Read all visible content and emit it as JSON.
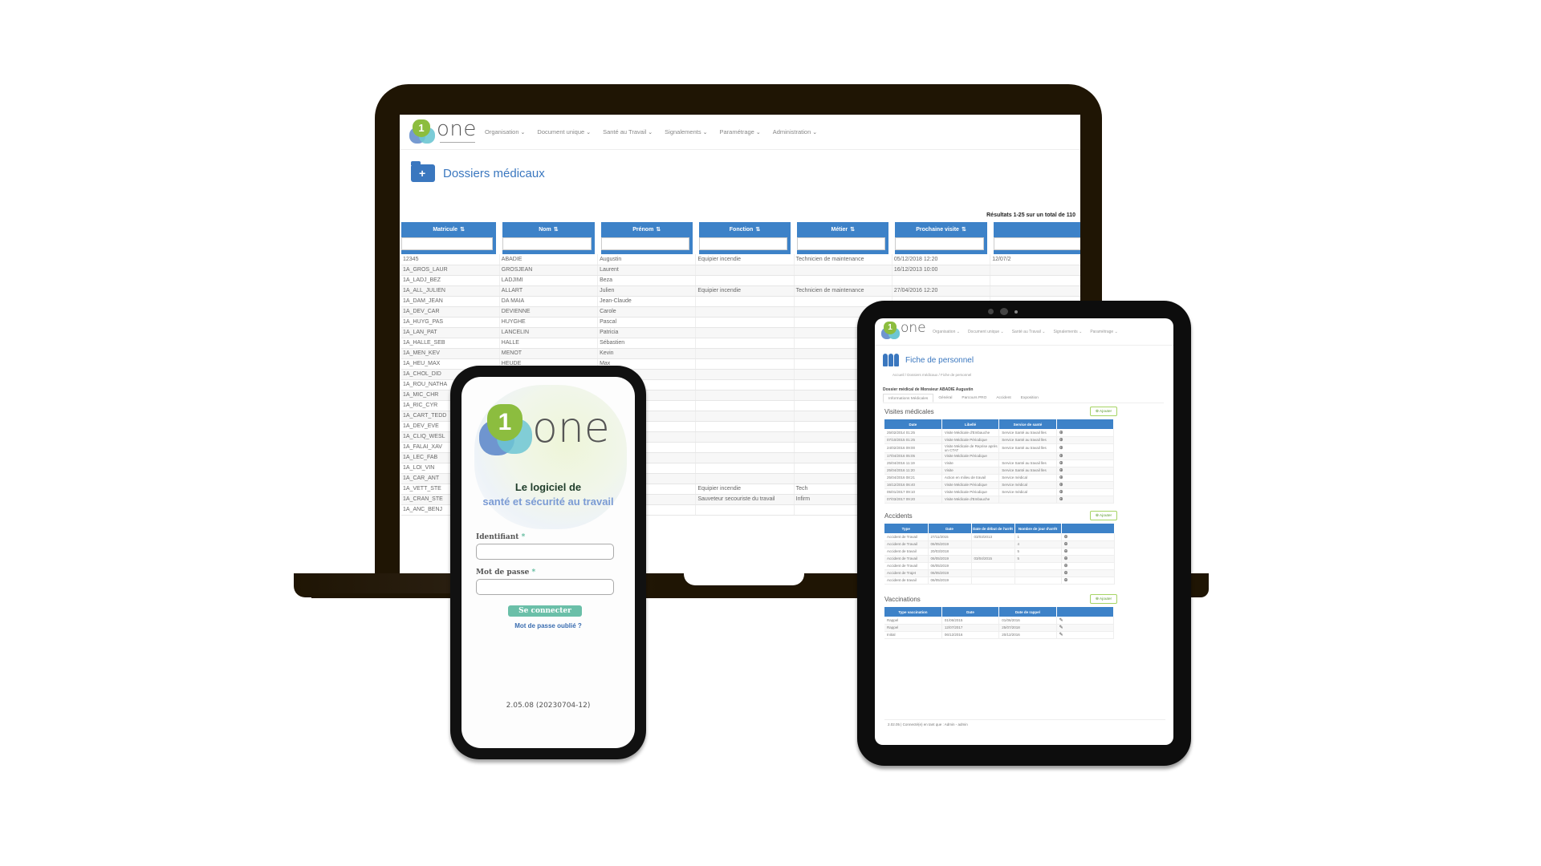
{
  "brand": {
    "logo_digit": "1",
    "logo_word": "one",
    "colors": {
      "green": "#8cbd3f",
      "blue": "#6f95cf",
      "teal": "#6dc6d3",
      "primary": "#3d82c8",
      "laptop_frame": "#1f1504"
    }
  },
  "laptop": {
    "nav": [
      {
        "label": "Organisation",
        "icon": "chevron-down-icon"
      },
      {
        "label": "Document unique",
        "icon": "chevron-down-icon"
      },
      {
        "label": "Santé au Travail",
        "icon": "chevron-down-icon"
      },
      {
        "label": "Signalements",
        "icon": "chevron-down-icon"
      },
      {
        "label": "Paramétrage",
        "icon": "chevron-down-icon"
      },
      {
        "label": "Administration",
        "icon": "chevron-down-icon"
      }
    ],
    "page_title": "Dossiers médicaux",
    "page_icon": "medical-folder-icon",
    "results_text": "Résultats 1-25 sur un total de 110",
    "columns": [
      "Matricule",
      "Nom",
      "Prénom",
      "Fonction",
      "Métier",
      "Prochaine visite",
      ""
    ],
    "sort_glyph": "⇅",
    "rows": [
      [
        "12345",
        "ABADIE",
        "Augustin",
        "Equipier incendie",
        "Technicien de maintenance",
        "05/12/2018 12:20",
        "12/07/2"
      ],
      [
        "1A_GROS_LAUR",
        "GROSJEAN",
        "Laurent",
        "",
        "",
        "16/12/2013 10:00",
        ""
      ],
      [
        "1A_LADJ_BEZ",
        "LADJIMI",
        "Beza",
        "",
        "",
        "",
        ""
      ],
      [
        "1A_ALL_JULIEN",
        "ALLART",
        "Julien",
        "Equipier incendie",
        "Technicien de maintenance",
        "27/04/2016 12:20",
        ""
      ],
      [
        "1A_DAM_JEAN",
        "DA MAIA",
        "Jean-Claude",
        "",
        "",
        "",
        ""
      ],
      [
        "1A_DEV_CAR",
        "DEVIENNE",
        "Carole",
        "",
        "",
        "",
        ""
      ],
      [
        "1A_HUYG_PAS",
        "HUYGHE",
        "Pascal",
        "",
        "",
        "",
        ""
      ],
      [
        "1A_LAN_PAT",
        "LANCELIN",
        "Patricia",
        "",
        "",
        "",
        ""
      ],
      [
        "1A_HALLE_SEB",
        "HALLE",
        "Sébastien",
        "",
        "",
        "",
        ""
      ],
      [
        "1A_MEN_KEV",
        "MENOT",
        "Kevin",
        "",
        "",
        "",
        ""
      ],
      [
        "1A_HEU_MAX",
        "HEUDE",
        "Max",
        "",
        "",
        "",
        ""
      ],
      [
        "1A_CHOL_DID",
        "",
        "",
        "",
        "",
        "",
        ""
      ],
      [
        "1A_ROU_NATHA",
        "",
        "",
        "",
        "",
        "",
        ""
      ],
      [
        "1A_MIC_CHR",
        "",
        "",
        "",
        "",
        "",
        ""
      ],
      [
        "1A_RIC_CYR",
        "",
        "",
        "",
        "",
        "",
        ""
      ],
      [
        "1A_CART_TEDD",
        "",
        "",
        "",
        "",
        "",
        ""
      ],
      [
        "1A_DEV_EVE",
        "",
        "",
        "",
        "",
        "",
        ""
      ],
      [
        "1A_CLIQ_WESL",
        "",
        "",
        "",
        "",
        "",
        ""
      ],
      [
        "1A_FALAI_XAV",
        "",
        "",
        "",
        "",
        "",
        ""
      ],
      [
        "1A_LEC_FAB",
        "",
        "",
        "",
        "",
        "",
        ""
      ],
      [
        "1A_LOI_VIN",
        "",
        "",
        "",
        "",
        "",
        ""
      ],
      [
        "1A_CAR_ANT",
        "",
        "",
        "",
        "",
        "",
        ""
      ],
      [
        "1A_VETT_STE",
        "",
        "",
        "Equipier incendie",
        "Tech",
        "",
        ""
      ],
      [
        "1A_CRAN_STE",
        "",
        "",
        "Sauveteur secouriste du travail",
        "Infirm",
        "",
        ""
      ],
      [
        "1A_ANC_BENJ",
        "",
        "",
        "",
        "",
        "",
        ""
      ]
    ]
  },
  "phone": {
    "tagline_line1": "Le logiciel de",
    "tagline_line2": "santé et sécurité au travail",
    "username_label": "Identifiant",
    "username_value": "",
    "password_label": "Mot de passe",
    "password_value": "",
    "required_mark": "*",
    "login_button": "Se connecter",
    "forgot_link": "Mot de passe oublié ?",
    "version": "2.05.08 (20230704-12)"
  },
  "tablet": {
    "nav": [
      "Organisation ⌄",
      "Document unique ⌄",
      "Santé au Travail ⌄",
      "Signalements ⌄",
      "Paramétrage ⌄"
    ],
    "page_title": "Fiche de personnel",
    "breadcrumb": "Accueil / Dossiers médicaux / Fiche de personnel",
    "dossier_title": "Dossier médical de Monsieur ABADIE Augustin",
    "tabs": [
      "Informations Médicales",
      "Général",
      "Parcours PRO",
      "Accident",
      "Exposition"
    ],
    "add_button": "⊕ Ajouter",
    "visites": {
      "title": "Visites médicales",
      "columns": [
        "Date",
        "Libellé",
        "Service de santé",
        ""
      ],
      "rows": [
        [
          "25/02/2014 01:25",
          "Visite Médicale d'Embauche",
          "Service Santé au travail lles",
          "⊕"
        ],
        [
          "07/10/2015 01:25",
          "Visite Médicale Périodique",
          "Service Santé au travail lles",
          "⊕"
        ],
        [
          "24/02/2016 09:00",
          "Visite Médicale de Reprise après un CTAT",
          "Service Santé au travail lles",
          "⊕"
        ],
        [
          "17/04/2016 05:05",
          "Visite Médicale Périodique",
          "",
          "⊕"
        ],
        [
          "25/04/2016 11:19",
          "Visite",
          "Service Santé au travail lles",
          "⊕"
        ],
        [
          "25/04/2016 11:20",
          "Visite",
          "Service Santé au travail lles",
          "⊕"
        ],
        [
          "25/04/2016 08:21",
          "Action en milieu de travail",
          "Service médical",
          "⊕"
        ],
        [
          "16/12/2016 06:40",
          "Visite Médicale Périodique",
          "Service médical",
          "⊕"
        ],
        [
          "05/01/2017 09:10",
          "Visite Médicale Périodique",
          "Service médical",
          "⊕"
        ],
        [
          "07/03/2017 09:20",
          "Visite Médicale d'Embauche",
          "",
          "⊕"
        ]
      ]
    },
    "accidents": {
      "title": "Accidents",
      "columns": [
        "Type",
        "Date",
        "Date de début de l'arrêt",
        "Nombre de jour d'arrêt",
        ""
      ],
      "rows": [
        [
          "Accident de Travail",
          "27/11/2015",
          "03/03/2013",
          "1",
          "⊕"
        ],
        [
          "Accident de Travail",
          "06/05/2019",
          "",
          "4",
          "⊕"
        ],
        [
          "Accident de travail",
          "20/03/2018",
          "",
          "5",
          "⊕"
        ],
        [
          "Accident de Travail",
          "06/05/2019",
          "03/04/2015",
          "5",
          "⊕"
        ],
        [
          "Accident de Travail",
          "06/05/2019",
          "",
          "",
          "⊕"
        ],
        [
          "Accident de Trajet",
          "06/05/2019",
          "",
          "",
          "⊕"
        ],
        [
          "Accident de travail",
          "06/05/2019",
          "",
          "",
          "⊕"
        ]
      ]
    },
    "vaccinations": {
      "title": "Vaccinations",
      "columns": [
        "Type vaccination",
        "Date",
        "Date de rappel",
        ""
      ],
      "rows": [
        [
          "Rappel",
          "01/06/2015",
          "01/06/2016",
          "✎"
        ],
        [
          "Rappel",
          "12/07/2017",
          "25/07/2018",
          "✎"
        ],
        [
          "Initial",
          "06/12/2016",
          "20/12/2016",
          "✎"
        ]
      ]
    },
    "footer": "2.02.05 | Connecté(e) en tant que : Admin - admin"
  }
}
